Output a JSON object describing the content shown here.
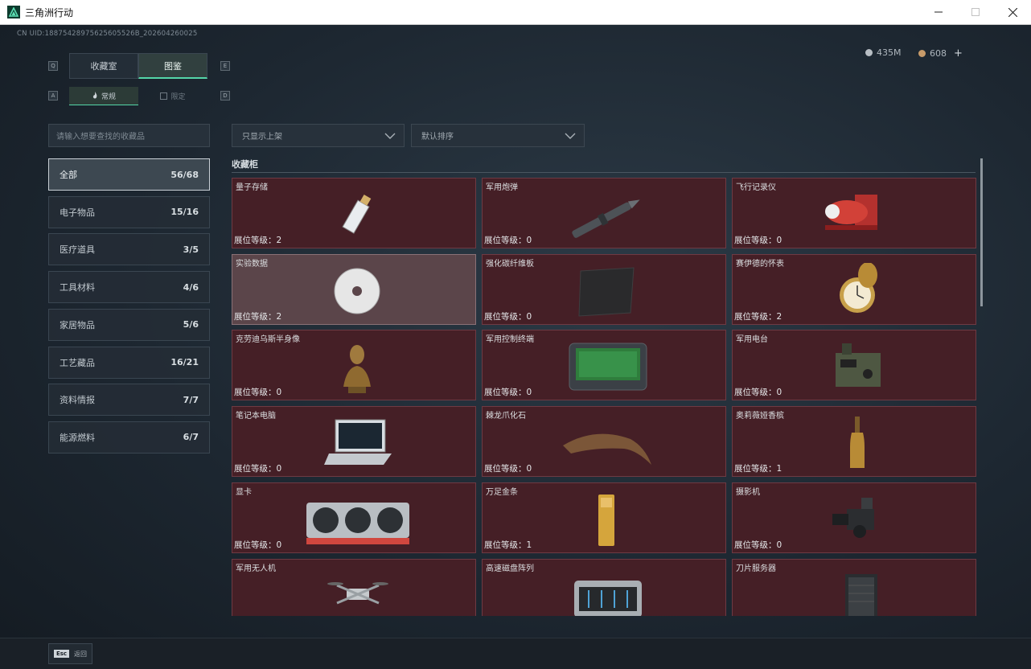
{
  "window": {
    "title": "三角洲行动",
    "minimize_glyph": "—",
    "maximize_glyph": "☐",
    "close_glyph": "✕"
  },
  "header": {
    "uid": "CN UID:18875428975625605526B_202604260025",
    "currencies": [
      {
        "icon": "silver-coin-icon",
        "value": "435M",
        "color": "#b8bec4"
      },
      {
        "icon": "bronze-coin-icon",
        "value": "608",
        "color": "#c79b6a"
      }
    ],
    "plus_glyph": "+"
  },
  "tabs": {
    "key_left": "Q",
    "key_right": "E",
    "items": [
      {
        "label": "收藏室",
        "active": false
      },
      {
        "label": "图鉴",
        "active": true
      }
    ]
  },
  "subtabs": {
    "key_left": "A",
    "key_right": "D",
    "items": [
      {
        "label": "常规",
        "active": true
      },
      {
        "label": "限定",
        "active": false
      }
    ]
  },
  "filters": {
    "search_placeholder": "请输入想要查找的收藏品",
    "dropdown_shelf": "只显示上架",
    "dropdown_sort": "默认排序"
  },
  "categories": [
    {
      "label": "全部",
      "count": "56/68",
      "active": true
    },
    {
      "label": "电子物品",
      "count": "15/16",
      "active": false
    },
    {
      "label": "医疗道具",
      "count": "3/5",
      "active": false
    },
    {
      "label": "工具材料",
      "count": "4/6",
      "active": false
    },
    {
      "label": "家居物品",
      "count": "5/6",
      "active": false
    },
    {
      "label": "工艺藏品",
      "count": "16/21",
      "active": false
    },
    {
      "label": "资料情报",
      "count": "7/7",
      "active": false
    },
    {
      "label": "能源燃料",
      "count": "6/7",
      "active": false
    }
  ],
  "cabinet": {
    "title": "收藏柜",
    "level_label": "展位等级：",
    "items": [
      {
        "name": "量子存储",
        "level": "2",
        "icon": "usb-drive-icon"
      },
      {
        "name": "军用炮弹",
        "level": "0",
        "icon": "artillery-shell-icon"
      },
      {
        "name": "飞行记录仪",
        "level": "0",
        "icon": "flight-recorder-icon"
      },
      {
        "name": "实验数据",
        "level": "2",
        "icon": "data-disc-icon",
        "highlight": true
      },
      {
        "name": "强化碳纤维板",
        "level": "0",
        "icon": "carbon-plate-icon"
      },
      {
        "name": "赛伊德的怀表",
        "level": "2",
        "icon": "pocket-watch-icon"
      },
      {
        "name": "克劳迪乌斯半身像",
        "level": "0",
        "icon": "bust-statue-icon"
      },
      {
        "name": "军用控制终端",
        "level": "0",
        "icon": "control-terminal-icon"
      },
      {
        "name": "军用电台",
        "level": "0",
        "icon": "military-radio-icon"
      },
      {
        "name": "笔记本电脑",
        "level": "0",
        "icon": "laptop-icon"
      },
      {
        "name": "棘龙爪化石",
        "level": "0",
        "icon": "claw-fossil-icon"
      },
      {
        "name": "奥莉薇娅香槟",
        "level": "1",
        "icon": "champagne-bottle-icon"
      },
      {
        "name": "显卡",
        "level": "0",
        "icon": "graphics-card-icon"
      },
      {
        "name": "万足金条",
        "level": "1",
        "icon": "gold-bar-icon"
      },
      {
        "name": "摄影机",
        "level": "0",
        "icon": "video-camera-icon"
      },
      {
        "name": "军用无人机",
        "level": "",
        "icon": "drone-icon"
      },
      {
        "name": "高速磁盘阵列",
        "level": "",
        "icon": "disk-array-icon"
      },
      {
        "name": "刀片服务器",
        "level": "",
        "icon": "blade-server-icon"
      }
    ]
  },
  "footer": {
    "esc_key": "Esc",
    "esc_label": "返回"
  }
}
